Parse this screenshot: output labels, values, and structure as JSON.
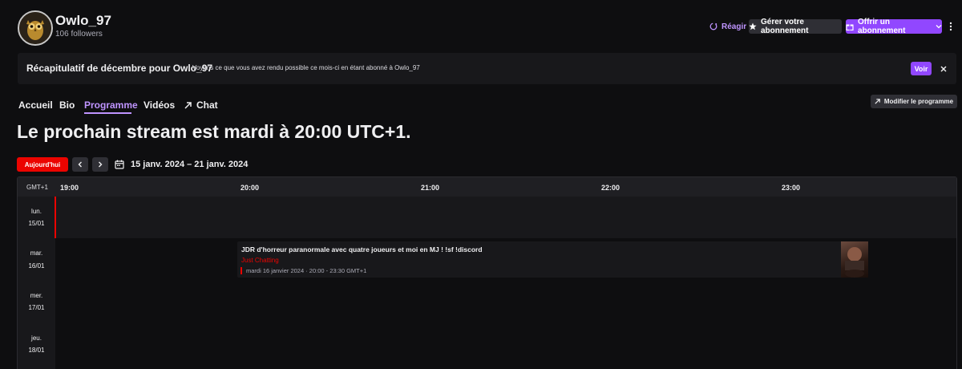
{
  "channel": {
    "name": "Owlo_97",
    "followers": "106 followers"
  },
  "header": {
    "react_label": "Réagir",
    "manage_label": "Gérer votre abonnement",
    "gift_label": "Offrir un abonnement"
  },
  "recap": {
    "title": "Récapitulatif de décembre pour Owlo_97",
    "text": "Voyons ce que vous avez rendu possible ce mois-ci en étant abonné à Owlo_97",
    "button": "Voir"
  },
  "tabs": [
    {
      "label": "Accueil"
    },
    {
      "label": "Bio"
    },
    {
      "label": "Programme",
      "active": true
    },
    {
      "label": "Vidéos"
    },
    {
      "label": "Chat"
    }
  ],
  "edit_schedule_label": "Modifier le programme",
  "headline": "Le prochain stream est mardi à 20:00 UTC+1.",
  "nav": {
    "today_label": "Aujourd'hui",
    "date_range": "15 janv. 2024 – 21 janv. 2024"
  },
  "schedule": {
    "timezone": "GMT+1",
    "hours": [
      "19:00",
      "20:00",
      "21:00",
      "22:00",
      "23:00"
    ],
    "days": [
      {
        "label": "lun.",
        "date": "15/01"
      },
      {
        "label": "mar.",
        "date": "16/01"
      },
      {
        "label": "mer.",
        "date": "17/01"
      },
      {
        "label": "jeu.",
        "date": "18/01"
      }
    ],
    "event": {
      "title": "JDR d'horreur paranormale avec quatre joueurs et moi en MJ ! !sf !discord",
      "category": "Just Chatting",
      "meta": "mardi 16 janvier 2024 · 20:00 - 23:30 GMT+1"
    }
  },
  "colors": {
    "accent": "#9147ff",
    "accent_text": "#bf94ff",
    "live_red": "#eb0400",
    "bg": "#0e0e10"
  }
}
